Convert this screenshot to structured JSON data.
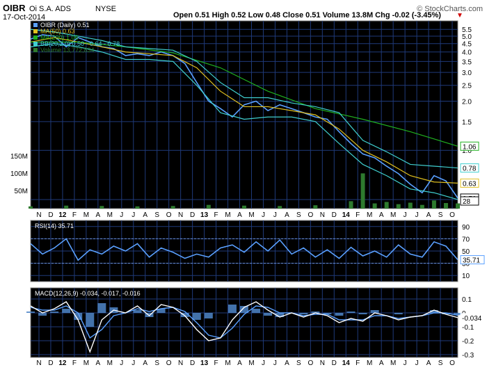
{
  "header": {
    "symbol": "OIBR",
    "company": "Oi S.A. ADS",
    "exchange": "NYSE",
    "date": "17-Oct-2014",
    "quote": "Open 0.51  High 0.52  Low 0.48  Close 0.51  Volume 13.8M  Chg -0.02 (-3.45%)",
    "change_arrow": "▼",
    "watermark": "© StockCharts.com"
  },
  "colors": {
    "panel_bg": "#000000",
    "grid": "#1f3a7a",
    "price": "#5aa0ff",
    "bb": "#40d0d0",
    "ma50": "#e0c020",
    "ma200": "#20b020",
    "volume": "#2e7a2e",
    "rsi": "#5aa0ff",
    "macd": "#ffffff",
    "signal": "#5aa0ff",
    "hist": "#4f86c8"
  },
  "chart_data": [
    {
      "type": "line",
      "panel": "price",
      "legend": [
        {
          "label": "OIBR (Daily) 0.51",
          "color": "#5aa0ff"
        },
        {
          "label": "MA(50) 0.63",
          "color": "#e0c020"
        },
        {
          "label": "MA(200) 1.06",
          "color": "#20b020"
        },
        {
          "label": "BB(20,2.0) 0.50 - 0.64 - 0.78",
          "color": "#40d0d0"
        },
        {
          "label": "Volume 13,772,834",
          "color": "#2e7a2e"
        }
      ],
      "y_scale": "log",
      "ylim": [
        0.44,
        6.2
      ],
      "y_ticks": [
        0.5,
        1.0,
        1.5,
        2.0,
        2.5,
        3.0,
        3.5,
        4.0,
        4.5,
        5.0,
        5.5
      ],
      "y_tick_labels": [
        "",
        "1.0",
        "1.5",
        "2.0",
        "2.5",
        "3.0",
        "3.5",
        "4.0",
        "4.5",
        "5.0",
        "5.5"
      ],
      "volume_ticks": [
        "150M",
        "100M",
        "50M"
      ],
      "last_value_labels": [
        {
          "label": "1.06",
          "value": 1.06,
          "color": "#20b020"
        },
        {
          "label": "0.78",
          "value": 0.78,
          "color": "#40d0d0"
        },
        {
          "label": "0.63",
          "value": 0.63,
          "color": "#e0c020"
        },
        {
          "label": "0.51",
          "value": 0.51,
          "color": "#000000"
        },
        {
          "label": "28",
          "value": 0.49,
          "color": "#000000"
        }
      ],
      "series": [
        {
          "name": "OIBR (Daily) 0.51",
          "x": [
            0,
            1,
            2,
            3,
            4,
            5,
            6,
            7,
            8,
            9,
            10,
            11,
            12,
            13,
            14,
            15,
            16,
            17,
            18,
            19,
            20,
            21,
            22,
            23,
            24,
            25,
            26,
            27,
            28,
            29,
            30,
            31,
            32,
            33,
            34,
            35,
            36
          ],
          "y": [
            4.8,
            5.1,
            5.0,
            4.3,
            4.9,
            4.6,
            4.3,
            4.2,
            3.8,
            3.9,
            3.8,
            4.0,
            3.8,
            3.4,
            2.6,
            2.0,
            1.8,
            1.6,
            1.9,
            2.0,
            1.75,
            1.9,
            1.8,
            1.7,
            1.6,
            1.55,
            1.3,
            1.1,
            0.95,
            0.9,
            0.8,
            0.72,
            0.62,
            0.55,
            0.7,
            0.65,
            0.51
          ]
        },
        {
          "name": "MA(50) 0.63",
          "x": [
            0,
            2,
            4,
            6,
            8,
            10,
            12,
            14,
            16,
            18,
            20,
            22,
            24,
            26,
            28,
            30,
            32,
            34,
            36
          ],
          "y": [
            4.6,
            4.9,
            4.6,
            4.3,
            4.0,
            3.9,
            3.8,
            3.2,
            2.3,
            1.85,
            1.85,
            1.75,
            1.65,
            1.35,
            1.0,
            0.85,
            0.7,
            0.64,
            0.63
          ]
        },
        {
          "name": "MA(200) 1.06",
          "x": [
            0,
            4,
            8,
            12,
            16,
            20,
            24,
            28,
            32,
            36
          ],
          "y": [
            4.6,
            4.6,
            4.3,
            3.95,
            3.2,
            2.3,
            1.8,
            1.55,
            1.3,
            1.06
          ]
        },
        {
          "name": "BB upper",
          "x": [
            0,
            2,
            4,
            6,
            8,
            10,
            12,
            14,
            16,
            18,
            20,
            22,
            24,
            26,
            28,
            30,
            32,
            34,
            36
          ],
          "y": [
            5.5,
            5.3,
            5.0,
            4.7,
            4.3,
            4.2,
            4.1,
            3.5,
            2.6,
            2.1,
            2.1,
            1.95,
            1.85,
            1.7,
            1.15,
            0.98,
            0.82,
            0.8,
            0.78
          ]
        },
        {
          "name": "BB lower",
          "x": [
            0,
            2,
            4,
            6,
            8,
            10,
            12,
            14,
            16,
            18,
            20,
            22,
            24,
            26,
            28,
            30,
            32,
            34,
            36
          ],
          "y": [
            4.3,
            4.5,
            4.3,
            4.0,
            3.6,
            3.6,
            3.5,
            2.5,
            1.7,
            1.55,
            1.6,
            1.6,
            1.5,
            1.1,
            0.82,
            0.7,
            0.58,
            0.55,
            0.5
          ]
        }
      ],
      "volume": {
        "x": [
          0,
          3,
          6,
          9,
          12,
          15,
          18,
          21,
          24,
          27,
          28,
          29,
          30,
          31,
          32,
          33,
          34,
          35,
          36
        ],
        "values": [
          6,
          8,
          7,
          6,
          7,
          10,
          8,
          7,
          9,
          20,
          95,
          14,
          18,
          12,
          16,
          10,
          22,
          15,
          14
        ]
      }
    },
    {
      "type": "line",
      "panel": "rsi",
      "legend": "RSI(14) 35.71",
      "ylim": [
        0,
        100
      ],
      "y_ticks": [
        10,
        30,
        50,
        70,
        90
      ],
      "y_tick_labels": [
        "10",
        "30",
        "50",
        "70",
        "90"
      ],
      "bands": [
        30,
        70
      ],
      "last_value_label": "35.71",
      "series": [
        {
          "name": "RSI(14) 35.71",
          "x": [
            0,
            1,
            2,
            3,
            4,
            5,
            6,
            7,
            8,
            9,
            10,
            11,
            12,
            13,
            14,
            15,
            16,
            17,
            18,
            19,
            20,
            21,
            22,
            23,
            24,
            25,
            26,
            27,
            28,
            29,
            30,
            31,
            32,
            33,
            34,
            35,
            36
          ],
          "y": [
            62,
            45,
            55,
            70,
            35,
            52,
            45,
            58,
            50,
            62,
            40,
            55,
            48,
            38,
            45,
            40,
            55,
            60,
            48,
            65,
            50,
            68,
            45,
            55,
            40,
            52,
            38,
            56,
            42,
            50,
            40,
            60,
            45,
            40,
            65,
            58,
            35.71
          ]
        }
      ]
    },
    {
      "type": "line",
      "panel": "macd",
      "legend": "MACD(12,26,9) -0.034, -0.017, -0.016",
      "ylim": [
        -0.32,
        0.18
      ],
      "y_ticks": [
        0.1,
        0.0,
        -0.1,
        -0.2,
        -0.3
      ],
      "y_tick_labels": [
        "0.1",
        "0",
        "-0.1",
        "-0.2",
        "-0.3"
      ],
      "last_value_label": "-0.034",
      "series": [
        {
          "name": "MACD(12,26,9) -0.034",
          "x": [
            0,
            1,
            2,
            3,
            4,
            5,
            6,
            7,
            8,
            9,
            10,
            11,
            12,
            13,
            14,
            15,
            16,
            17,
            18,
            19,
            20,
            21,
            22,
            23,
            24,
            25,
            26,
            27,
            28,
            29,
            30,
            31,
            32,
            33,
            34,
            35,
            36
          ],
          "y": [
            0.05,
            0.0,
            0.03,
            0.08,
            -0.05,
            -0.28,
            -0.05,
            0.02,
            0.0,
            0.05,
            -0.02,
            0.06,
            0.04,
            -0.02,
            -0.12,
            -0.2,
            -0.18,
            -0.05,
            0.04,
            0.08,
            0.02,
            -0.03,
            0.0,
            -0.03,
            0.0,
            -0.02,
            -0.07,
            -0.04,
            -0.06,
            0.0,
            -0.02,
            -0.05,
            -0.03,
            -0.02,
            0.02,
            -0.01,
            -0.034
          ]
        },
        {
          "name": "Signal -0.017",
          "x": [
            0,
            1,
            2,
            3,
            4,
            5,
            6,
            7,
            8,
            9,
            10,
            11,
            12,
            13,
            14,
            15,
            16,
            17,
            18,
            19,
            20,
            21,
            22,
            23,
            24,
            25,
            26,
            27,
            28,
            29,
            30,
            31,
            32,
            33,
            34,
            35,
            36
          ],
          "y": [
            0.04,
            0.02,
            0.02,
            0.05,
            0.0,
            -0.18,
            -0.12,
            -0.02,
            0.0,
            0.03,
            0.01,
            0.03,
            0.04,
            0.01,
            -0.07,
            -0.16,
            -0.18,
            -0.11,
            -0.01,
            0.05,
            0.04,
            0.0,
            0.0,
            -0.02,
            -0.01,
            -0.01,
            -0.05,
            -0.05,
            -0.05,
            -0.02,
            -0.02,
            -0.04,
            -0.03,
            -0.02,
            0.0,
            0.0,
            -0.017
          ]
        },
        {
          "name": "Histogram -0.016",
          "x": [
            0,
            1,
            2,
            3,
            4,
            5,
            6,
            7,
            8,
            9,
            10,
            11,
            12,
            13,
            14,
            15,
            16,
            17,
            18,
            19,
            20,
            21,
            22,
            23,
            24,
            25,
            26,
            27,
            28,
            29,
            30,
            31,
            32,
            33,
            34,
            35,
            36
          ],
          "y": [
            0.01,
            -0.02,
            0.01,
            0.03,
            -0.05,
            -0.1,
            0.07,
            0.04,
            0.0,
            0.02,
            -0.03,
            0.03,
            0.0,
            -0.03,
            -0.05,
            -0.04,
            0.0,
            0.06,
            0.05,
            0.03,
            -0.02,
            -0.03,
            0.0,
            -0.01,
            0.01,
            -0.01,
            -0.02,
            0.01,
            -0.01,
            0.02,
            0.0,
            -0.01,
            0.0,
            0.0,
            0.02,
            -0.01,
            -0.016
          ]
        }
      ]
    }
  ],
  "x_axis": {
    "labels": [
      "N",
      "D",
      "12",
      "F",
      "M",
      "A",
      "M",
      "J",
      "J",
      "A",
      "S",
      "O",
      "N",
      "D",
      "13",
      "F",
      "M",
      "A",
      "M",
      "J",
      "J",
      "A",
      "S",
      "O",
      "N",
      "D",
      "14",
      "F",
      "M",
      "A",
      "M",
      "J",
      "J",
      "A",
      "S",
      "O"
    ],
    "bold": [
      "12",
      "13",
      "14"
    ]
  }
}
